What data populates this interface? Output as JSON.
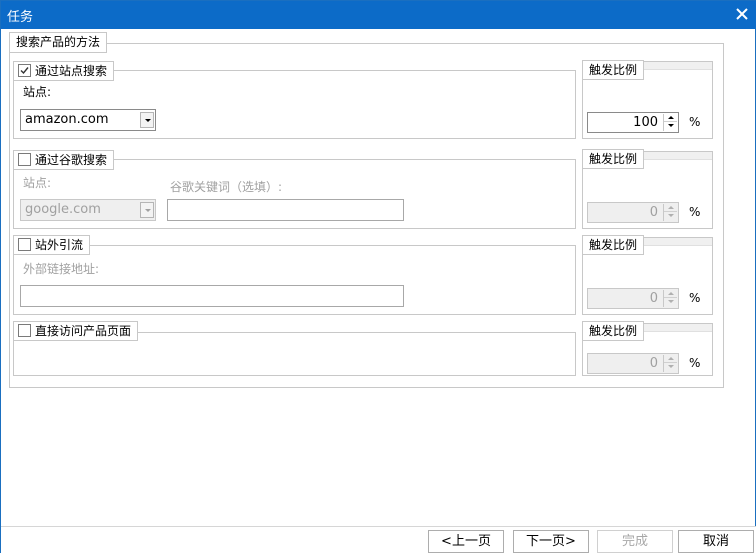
{
  "window": {
    "title": "任务"
  },
  "group": {
    "title": "搜索产品的方法"
  },
  "ratio_label": "触发比例",
  "percent": "%",
  "options": [
    {
      "label": "通过站点搜索",
      "checked": true,
      "site_label": "站点:",
      "site_value": "amazon.com",
      "ratio": "100"
    },
    {
      "label": "通过谷歌搜索",
      "checked": false,
      "site_label": "站点:",
      "site_value": "google.com",
      "keyword_label": "谷歌关键词（选填）:",
      "keyword_value": "",
      "ratio": "0"
    },
    {
      "label": "站外引流",
      "checked": false,
      "link_label": "外部链接地址:",
      "link_value": "",
      "ratio": "0"
    },
    {
      "label": "直接访问产品页面",
      "checked": false,
      "ratio": "0"
    }
  ],
  "footer": {
    "prev": "<上一页",
    "next": "下一页>",
    "finish": "完成",
    "cancel": "取消"
  }
}
